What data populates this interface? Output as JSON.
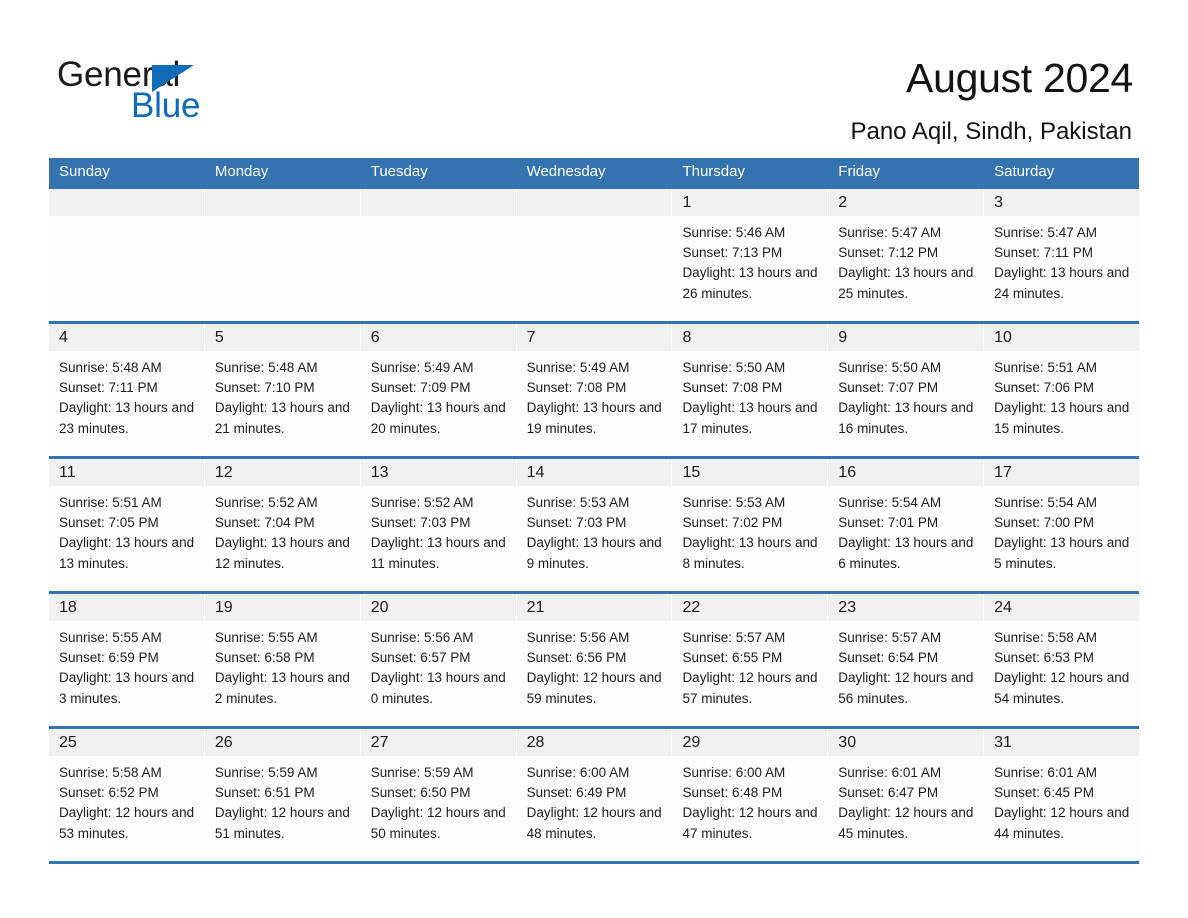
{
  "brand": {
    "word_one": "General",
    "word_two": "Blue",
    "accent_color": "#0f6bb5",
    "triangle_icon": "brand-triangle-icon"
  },
  "header": {
    "title": "August 2024",
    "subtitle": "Pano Aqil, Sindh, Pakistan"
  },
  "theme": {
    "header_band": "#3573b0",
    "daynum_band": "#f0f0f0",
    "text": "#1d1d1d"
  },
  "calendar": {
    "weekday_headers": [
      "Sunday",
      "Monday",
      "Tuesday",
      "Wednesday",
      "Thursday",
      "Friday",
      "Saturday"
    ],
    "weeks": [
      [
        {
          "day": "",
          "empty": true
        },
        {
          "day": "",
          "empty": true
        },
        {
          "day": "",
          "empty": true
        },
        {
          "day": "",
          "empty": true
        },
        {
          "day": "1",
          "sunrise": "Sunrise: 5:46 AM",
          "sunset": "Sunset: 7:13 PM",
          "daylight": "Daylight: 13 hours and 26 minutes."
        },
        {
          "day": "2",
          "sunrise": "Sunrise: 5:47 AM",
          "sunset": "Sunset: 7:12 PM",
          "daylight": "Daylight: 13 hours and 25 minutes."
        },
        {
          "day": "3",
          "sunrise": "Sunrise: 5:47 AM",
          "sunset": "Sunset: 7:11 PM",
          "daylight": "Daylight: 13 hours and 24 minutes."
        }
      ],
      [
        {
          "day": "4",
          "sunrise": "Sunrise: 5:48 AM",
          "sunset": "Sunset: 7:11 PM",
          "daylight": "Daylight: 13 hours and 23 minutes."
        },
        {
          "day": "5",
          "sunrise": "Sunrise: 5:48 AM",
          "sunset": "Sunset: 7:10 PM",
          "daylight": "Daylight: 13 hours and 21 minutes."
        },
        {
          "day": "6",
          "sunrise": "Sunrise: 5:49 AM",
          "sunset": "Sunset: 7:09 PM",
          "daylight": "Daylight: 13 hours and 20 minutes."
        },
        {
          "day": "7",
          "sunrise": "Sunrise: 5:49 AM",
          "sunset": "Sunset: 7:08 PM",
          "daylight": "Daylight: 13 hours and 19 minutes."
        },
        {
          "day": "8",
          "sunrise": "Sunrise: 5:50 AM",
          "sunset": "Sunset: 7:08 PM",
          "daylight": "Daylight: 13 hours and 17 minutes."
        },
        {
          "day": "9",
          "sunrise": "Sunrise: 5:50 AM",
          "sunset": "Sunset: 7:07 PM",
          "daylight": "Daylight: 13 hours and 16 minutes."
        },
        {
          "day": "10",
          "sunrise": "Sunrise: 5:51 AM",
          "sunset": "Sunset: 7:06 PM",
          "daylight": "Daylight: 13 hours and 15 minutes."
        }
      ],
      [
        {
          "day": "11",
          "sunrise": "Sunrise: 5:51 AM",
          "sunset": "Sunset: 7:05 PM",
          "daylight": "Daylight: 13 hours and 13 minutes."
        },
        {
          "day": "12",
          "sunrise": "Sunrise: 5:52 AM",
          "sunset": "Sunset: 7:04 PM",
          "daylight": "Daylight: 13 hours and 12 minutes."
        },
        {
          "day": "13",
          "sunrise": "Sunrise: 5:52 AM",
          "sunset": "Sunset: 7:03 PM",
          "daylight": "Daylight: 13 hours and 11 minutes."
        },
        {
          "day": "14",
          "sunrise": "Sunrise: 5:53 AM",
          "sunset": "Sunset: 7:03 PM",
          "daylight": "Daylight: 13 hours and 9 minutes."
        },
        {
          "day": "15",
          "sunrise": "Sunrise: 5:53 AM",
          "sunset": "Sunset: 7:02 PM",
          "daylight": "Daylight: 13 hours and 8 minutes."
        },
        {
          "day": "16",
          "sunrise": "Sunrise: 5:54 AM",
          "sunset": "Sunset: 7:01 PM",
          "daylight": "Daylight: 13 hours and 6 minutes."
        },
        {
          "day": "17",
          "sunrise": "Sunrise: 5:54 AM",
          "sunset": "Sunset: 7:00 PM",
          "daylight": "Daylight: 13 hours and 5 minutes."
        }
      ],
      [
        {
          "day": "18",
          "sunrise": "Sunrise: 5:55 AM",
          "sunset": "Sunset: 6:59 PM",
          "daylight": "Daylight: 13 hours and 3 minutes."
        },
        {
          "day": "19",
          "sunrise": "Sunrise: 5:55 AM",
          "sunset": "Sunset: 6:58 PM",
          "daylight": "Daylight: 13 hours and 2 minutes."
        },
        {
          "day": "20",
          "sunrise": "Sunrise: 5:56 AM",
          "sunset": "Sunset: 6:57 PM",
          "daylight": "Daylight: 13 hours and 0 minutes."
        },
        {
          "day": "21",
          "sunrise": "Sunrise: 5:56 AM",
          "sunset": "Sunset: 6:56 PM",
          "daylight": "Daylight: 12 hours and 59 minutes."
        },
        {
          "day": "22",
          "sunrise": "Sunrise: 5:57 AM",
          "sunset": "Sunset: 6:55 PM",
          "daylight": "Daylight: 12 hours and 57 minutes."
        },
        {
          "day": "23",
          "sunrise": "Sunrise: 5:57 AM",
          "sunset": "Sunset: 6:54 PM",
          "daylight": "Daylight: 12 hours and 56 minutes."
        },
        {
          "day": "24",
          "sunrise": "Sunrise: 5:58 AM",
          "sunset": "Sunset: 6:53 PM",
          "daylight": "Daylight: 12 hours and 54 minutes."
        }
      ],
      [
        {
          "day": "25",
          "sunrise": "Sunrise: 5:58 AM",
          "sunset": "Sunset: 6:52 PM",
          "daylight": "Daylight: 12 hours and 53 minutes."
        },
        {
          "day": "26",
          "sunrise": "Sunrise: 5:59 AM",
          "sunset": "Sunset: 6:51 PM",
          "daylight": "Daylight: 12 hours and 51 minutes."
        },
        {
          "day": "27",
          "sunrise": "Sunrise: 5:59 AM",
          "sunset": "Sunset: 6:50 PM",
          "daylight": "Daylight: 12 hours and 50 minutes."
        },
        {
          "day": "28",
          "sunrise": "Sunrise: 6:00 AM",
          "sunset": "Sunset: 6:49 PM",
          "daylight": "Daylight: 12 hours and 48 minutes."
        },
        {
          "day": "29",
          "sunrise": "Sunrise: 6:00 AM",
          "sunset": "Sunset: 6:48 PM",
          "daylight": "Daylight: 12 hours and 47 minutes."
        },
        {
          "day": "30",
          "sunrise": "Sunrise: 6:01 AM",
          "sunset": "Sunset: 6:47 PM",
          "daylight": "Daylight: 12 hours and 45 minutes."
        },
        {
          "day": "31",
          "sunrise": "Sunrise: 6:01 AM",
          "sunset": "Sunset: 6:45 PM",
          "daylight": "Daylight: 12 hours and 44 minutes."
        }
      ]
    ]
  }
}
